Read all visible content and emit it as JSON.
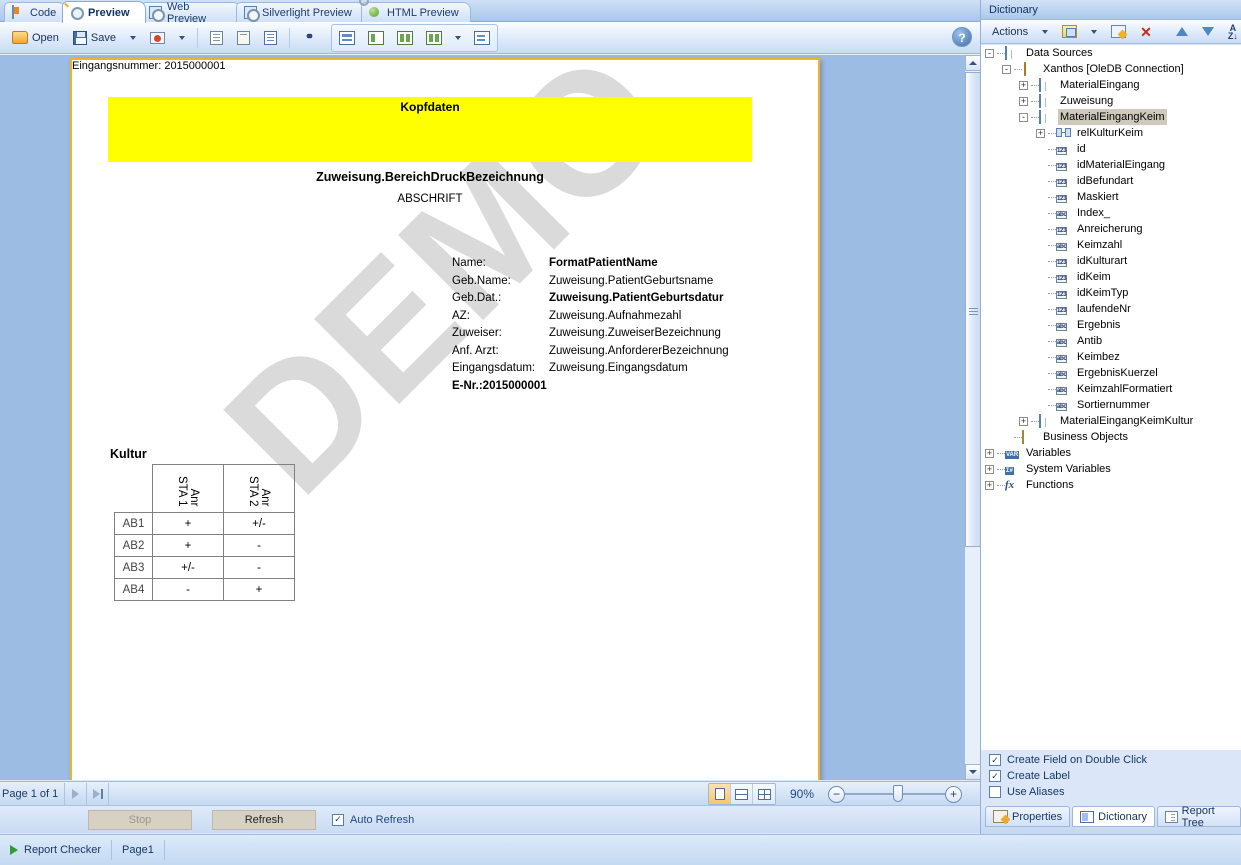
{
  "tabs": [
    {
      "label": "Code",
      "icon": "code-icon",
      "active": false
    },
    {
      "label": "Preview",
      "icon": "preview-icon",
      "active": true
    },
    {
      "label": "Web Preview",
      "icon": "web-preview-icon",
      "active": false
    },
    {
      "label": "Silverlight Preview",
      "icon": "silverlight-preview-icon",
      "active": false
    },
    {
      "label": "HTML Preview",
      "icon": "html-preview-icon",
      "active": false
    }
  ],
  "toolbar": {
    "open_label": "Open",
    "save_label": "Save",
    "help_label": "?"
  },
  "document": {
    "header_title": "Kopfdaten",
    "bereich": "Zuweisung.BereichDruckBezeichnung",
    "abschrift": "ABSCHRIFT",
    "watermark": "DEMO",
    "info_rows": [
      {
        "label": "Name:",
        "value": "FormatPatientName",
        "bold": true
      },
      {
        "label": "Geb.Name:",
        "value": "Zuweisung.PatientGeburtsname",
        "bold": false
      },
      {
        "label": "Geb.Dat.:",
        "value": "Zuweisung.PatientGeburtsdatur",
        "bold": true
      },
      {
        "label": "AZ:",
        "value": "Zuweisung.Aufnahmezahl",
        "bold": false
      },
      {
        "label": "Zuweiser:",
        "value": "Zuweisung.ZuweiserBezeichnung",
        "bold": false
      },
      {
        "label": "Anf. Arzt:",
        "value": "Zuweisung.AnfordererBezeichnung",
        "bold": false
      },
      {
        "label": "Eingangsdatum:",
        "value": "Zuweisung.Eingangsdatum",
        "bold": false
      }
    ],
    "enr": "E-Nr.:2015000001",
    "eingangsnummer": "Eingangsnummer: 2015000001",
    "kultur_title": "Kultur",
    "kultur_table": {
      "col_headers": [
        "STA 1\nAnr",
        "STA 2\nAnr"
      ],
      "col_header_lines": [
        [
          "STA 1",
          "Anr"
        ],
        [
          "STA 2",
          "Anr"
        ]
      ],
      "rows": [
        {
          "label": "AB1",
          "cells": [
            "+",
            "+/-"
          ]
        },
        {
          "label": "AB2",
          "cells": [
            "+",
            "-"
          ]
        },
        {
          "label": "AB3",
          "cells": [
            "+/-",
            "-"
          ]
        },
        {
          "label": "AB4",
          "cells": [
            "-",
            "+"
          ]
        }
      ]
    }
  },
  "navbar": {
    "page_info": "Page 1 of 1",
    "zoom_percent": "90%"
  },
  "refreshbar": {
    "stop_label": "Stop",
    "refresh_label": "Refresh",
    "auto_refresh_label": "Auto Refresh",
    "auto_refresh_checked": true
  },
  "statusbar": {
    "report_checker": "Report Checker",
    "page": "Page1"
  },
  "dictionary": {
    "title": "Dictionary",
    "actions_label": "Actions",
    "tree": [
      {
        "label": "Data Sources",
        "depth": 0,
        "expander": "-",
        "icon": "table-icon",
        "selected": false
      },
      {
        "label": "Xanthos [OleDB Connection]",
        "depth": 1,
        "expander": "-",
        "icon": "database-icon",
        "selected": false
      },
      {
        "label": "MaterialEingang",
        "depth": 2,
        "expander": "+",
        "icon": "table-icon",
        "selected": false
      },
      {
        "label": "Zuweisung",
        "depth": 2,
        "expander": "+",
        "icon": "table-icon",
        "selected": false
      },
      {
        "label": "MaterialEingangKeim",
        "depth": 2,
        "expander": "-",
        "icon": "table-icon",
        "selected": true
      },
      {
        "label": "relKulturKeim",
        "depth": 3,
        "expander": "+",
        "icon": "relation-icon",
        "selected": false
      },
      {
        "label": "id",
        "depth": 3,
        "expander": "",
        "icon": "number-icon",
        "selected": false
      },
      {
        "label": "idMaterialEingang",
        "depth": 3,
        "expander": "",
        "icon": "number-icon",
        "selected": false
      },
      {
        "label": "idBefundart",
        "depth": 3,
        "expander": "",
        "icon": "number-icon",
        "selected": false
      },
      {
        "label": "Maskiert",
        "depth": 3,
        "expander": "",
        "icon": "number-icon",
        "selected": false
      },
      {
        "label": "Index_",
        "depth": 3,
        "expander": "",
        "icon": "text-icon",
        "selected": false
      },
      {
        "label": "Anreicherung",
        "depth": 3,
        "expander": "",
        "icon": "number-icon",
        "selected": false
      },
      {
        "label": "Keimzahl",
        "depth": 3,
        "expander": "",
        "icon": "text-icon",
        "selected": false
      },
      {
        "label": "idKulturart",
        "depth": 3,
        "expander": "",
        "icon": "number-icon",
        "selected": false
      },
      {
        "label": "idKeim",
        "depth": 3,
        "expander": "",
        "icon": "number-icon",
        "selected": false
      },
      {
        "label": "idKeimTyp",
        "depth": 3,
        "expander": "",
        "icon": "number-icon",
        "selected": false
      },
      {
        "label": "laufendeNr",
        "depth": 3,
        "expander": "",
        "icon": "number-icon",
        "selected": false
      },
      {
        "label": "Ergebnis",
        "depth": 3,
        "expander": "",
        "icon": "text-icon",
        "selected": false
      },
      {
        "label": "Antib",
        "depth": 3,
        "expander": "",
        "icon": "text-icon",
        "selected": false
      },
      {
        "label": "Keimbez",
        "depth": 3,
        "expander": "",
        "icon": "text-icon",
        "selected": false
      },
      {
        "label": "ErgebnisKuerzel",
        "depth": 3,
        "expander": "",
        "icon": "text-icon",
        "selected": false
      },
      {
        "label": "KeimzahlFormatiert",
        "depth": 3,
        "expander": "",
        "icon": "text-icon",
        "selected": false
      },
      {
        "label": "Sortiernummer",
        "depth": 3,
        "expander": "",
        "icon": "text-icon",
        "selected": false
      },
      {
        "label": "MaterialEingangKeimKultur",
        "depth": 2,
        "expander": "+",
        "icon": "table-icon",
        "selected": false
      },
      {
        "label": "Business Objects",
        "depth": 1,
        "expander": "",
        "icon": "business-objects-icon",
        "selected": false
      },
      {
        "label": "Variables",
        "depth": 0,
        "expander": "+",
        "icon": "variables-icon",
        "selected": false
      },
      {
        "label": "System Variables",
        "depth": 0,
        "expander": "+",
        "icon": "system-variables-icon",
        "selected": false
      },
      {
        "label": "Functions",
        "depth": 0,
        "expander": "+",
        "icon": "functions-icon",
        "selected": false
      }
    ],
    "options": [
      {
        "label": "Create Field on Double Click",
        "checked": true
      },
      {
        "label": "Create Label",
        "checked": true
      },
      {
        "label": "Use Aliases",
        "checked": false
      }
    ],
    "panel_tabs": [
      {
        "label": "Properties",
        "icon": "properties-icon",
        "active": false
      },
      {
        "label": "Dictionary",
        "icon": "dictionary-icon",
        "active": true
      },
      {
        "label": "Report Tree",
        "icon": "report-tree-icon",
        "active": false
      }
    ]
  },
  "colors": {
    "highlight_yellow": "#ffff00",
    "page_border": "#f0b428",
    "selection": "#cec9bb",
    "accent_blue": "#1f4a86"
  }
}
